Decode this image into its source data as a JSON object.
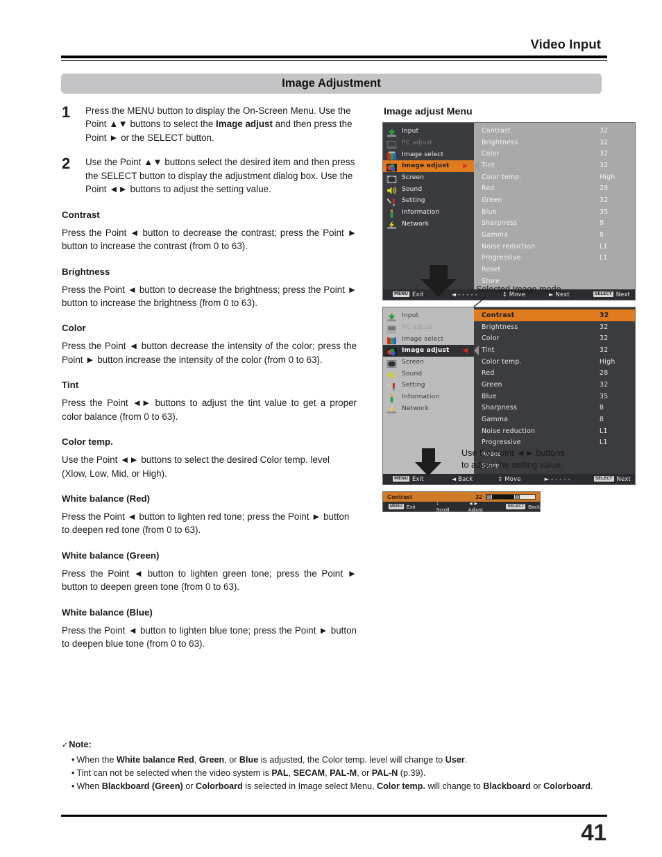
{
  "header": {
    "running_title": "Video Input"
  },
  "section": {
    "title": "Image Adjustment"
  },
  "steps": [
    {
      "num": "1",
      "html_id": "step1"
    },
    {
      "num": "2",
      "html_id": "step2"
    }
  ],
  "step1": {
    "t1": "Press the MENU button to display the On-Screen Menu. Use the Point ▲▼ buttons to select the ",
    "b1": "Image adjust",
    "t2": " and then press the Point ► or the SELECT button."
  },
  "step2": {
    "t1": "Use the Point ▲▼ buttons select the desired item and then press the SELECT button to display the adjustment dialog box. Use the Point ◄► buttons to adjust the setting value."
  },
  "sections": [
    {
      "heading": "Contrast",
      "body": "Press the Point ◄ button to decrease the contrast; press the Point ► button to increase the contrast (from 0 to 63)."
    },
    {
      "heading": "Brightness",
      "body": "Press the Point ◄ button to decrease the brightness; press the Point ► button to increase the brightness (from 0 to 63)."
    },
    {
      "heading": "Color",
      "body": "Press the Point ◄ button decrease the intensity of the color; press the Point ► button increase the intensity of the color (from 0 to 63)."
    },
    {
      "heading": "Tint",
      "body": "Press the Point ◄► buttons to adjust the tint value to get a proper color balance (from 0 to 63)."
    },
    {
      "heading": "Color temp.",
      "body": "Use the Point ◄► buttons to select the desired Color temp. level (Xlow, Low, Mid, or High)."
    },
    {
      "heading": "White balance (Red)",
      "body": "Press the Point ◄ button to lighten red tone; press the Point ► button to deepen red tone (from 0 to 63)."
    },
    {
      "heading": "White balance (Green)",
      "body": "Press the Point ◄ button to lighten green tone; press the Point ► button to deepen green tone (from 0 to 63)."
    },
    {
      "heading": "White balance (Blue)",
      "body": "Press the Point ◄ button to lighten blue tone; press the Point ► button to deepen blue tone (from 0 to 63)."
    }
  ],
  "note": {
    "check": "✓",
    "label": "Note:",
    "items": [
      {
        "p1": "When the ",
        "b1": "White balance Red",
        "p2": ", ",
        "b2": "Green",
        "p3": ", or ",
        "b3": "Blue",
        "p4": " is adjusted, the Color temp. level will change to ",
        "b4": "User",
        "p5": "."
      },
      {
        "p1": "Tint can not be selected when the video system is ",
        "b1": "PAL",
        "p2": ", ",
        "b2": "SECAM",
        "p3": ", ",
        "b3": "PAL-M",
        "p4": ", or ",
        "b4": "PAL-N",
        "p5": " (p.39)."
      },
      {
        "p1": "When ",
        "b1": "Blackboard (Green)",
        "p2": " or ",
        "b2": "Colorboard",
        "p3": " is selected in Image select Menu, ",
        "b3": "Color temp.",
        "p4": " will change to ",
        "b4": "Blackboard",
        "p5": " or ",
        "b5": "Colorboard",
        "p6": "."
      }
    ]
  },
  "right": {
    "menu_caption": "Image adjust Menu",
    "selected_image_mode_label": "Selected Image mode",
    "adjust_hint": "Use the Point ◄► buttons to adjust the setting value."
  },
  "osd": {
    "sidebar": [
      {
        "label": "Input",
        "icon": "input-icon",
        "state": "normal"
      },
      {
        "label": "PC adjust",
        "icon": "pc-adjust-icon",
        "state": "disabled"
      },
      {
        "label": "Image select",
        "icon": "image-select-icon",
        "state": "normal"
      },
      {
        "label": "Image adjust",
        "icon": "image-adjust-icon",
        "state": "selected"
      },
      {
        "label": "Screen",
        "icon": "screen-icon",
        "state": "normal"
      },
      {
        "label": "Sound",
        "icon": "sound-icon",
        "state": "normal"
      },
      {
        "label": "Setting",
        "icon": "setting-icon",
        "state": "normal"
      },
      {
        "label": "Information",
        "icon": "information-icon",
        "state": "normal"
      },
      {
        "label": "Network",
        "icon": "network-icon",
        "state": "normal"
      }
    ],
    "items": [
      {
        "name": "Contrast",
        "value": "32"
      },
      {
        "name": "Brightness",
        "value": "32"
      },
      {
        "name": "Color",
        "value": "32"
      },
      {
        "name": "Tint",
        "value": "32"
      },
      {
        "name": "Color temp.",
        "value": "High"
      },
      {
        "name": "Red",
        "value": "28"
      },
      {
        "name": "Green",
        "value": "32"
      },
      {
        "name": "Blue",
        "value": "35"
      },
      {
        "name": "Sharpness",
        "value": "8"
      },
      {
        "name": "Gamma",
        "value": "8"
      },
      {
        "name": "Noise reduction",
        "value": "L1"
      },
      {
        "name": "Progressive",
        "value": "L1"
      },
      {
        "name": "Reset",
        "value": ""
      },
      {
        "name": "Store",
        "value": ""
      }
    ],
    "footer_top": [
      {
        "key": "MENU",
        "label": "Exit"
      },
      {
        "key": "",
        "label": "◄ - - - - -"
      },
      {
        "key": "",
        "label": "↕ Move"
      },
      {
        "key": "",
        "label": "► Next"
      },
      {
        "key": "SELECT",
        "label": "Next"
      }
    ],
    "footer_bottom": [
      {
        "key": "MENU",
        "label": "Exit"
      },
      {
        "key": "",
        "label": "◄ Back"
      },
      {
        "key": "",
        "label": "↕ Move"
      },
      {
        "key": "",
        "label": "► - - - - -"
      },
      {
        "key": "SELECT",
        "label": "Next"
      }
    ],
    "slider": {
      "name": "Contrast",
      "value": "32",
      "footer": [
        {
          "key": "MENU",
          "label": "Exit"
        },
        {
          "key": "",
          "label": "↕ Scroll"
        },
        {
          "key": "",
          "label": "◄► Adjust"
        },
        {
          "key": "SELECT",
          "label": "Back"
        }
      ]
    }
  },
  "footer": {
    "page_number": "41"
  },
  "colors": {
    "accent_orange": "#e07b20",
    "section_bar": "#c4c3c6",
    "osd_dark": "#3a3b3e",
    "osd_light_panel": "#a9a9a9",
    "arrow_red": "#d93c20"
  }
}
